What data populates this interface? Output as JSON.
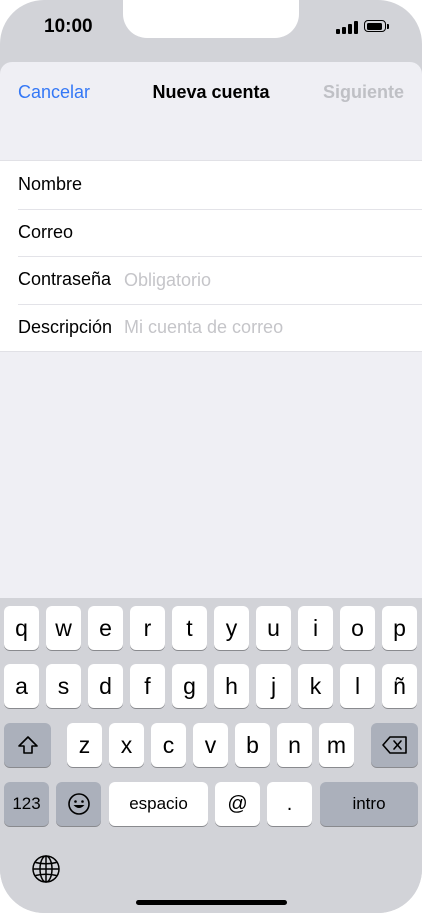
{
  "status_bar": {
    "time": "10:00"
  },
  "nav": {
    "cancel": "Cancelar",
    "title": "Nueva cuenta",
    "next": "Siguiente"
  },
  "form": {
    "name_label": "Nombre",
    "email_label": "Correo",
    "password_label": "Contraseña",
    "password_placeholder": "Obligatorio",
    "description_label": "Descripción",
    "description_placeholder": "Mi cuenta de correo"
  },
  "keyboard": {
    "row1": [
      "q",
      "w",
      "e",
      "r",
      "t",
      "y",
      "u",
      "i",
      "o",
      "p"
    ],
    "row2": [
      "a",
      "s",
      "d",
      "f",
      "g",
      "h",
      "j",
      "k",
      "l",
      "ñ"
    ],
    "row3": [
      "z",
      "x",
      "c",
      "v",
      "b",
      "n",
      "m"
    ],
    "numbers": "123",
    "space": "espacio",
    "at": "@",
    "dot": ".",
    "return": "intro",
    "icons": {
      "shift": "shift-icon",
      "delete": "backspace-icon",
      "emoji": "emoji-icon",
      "globe": "globe-icon"
    }
  }
}
